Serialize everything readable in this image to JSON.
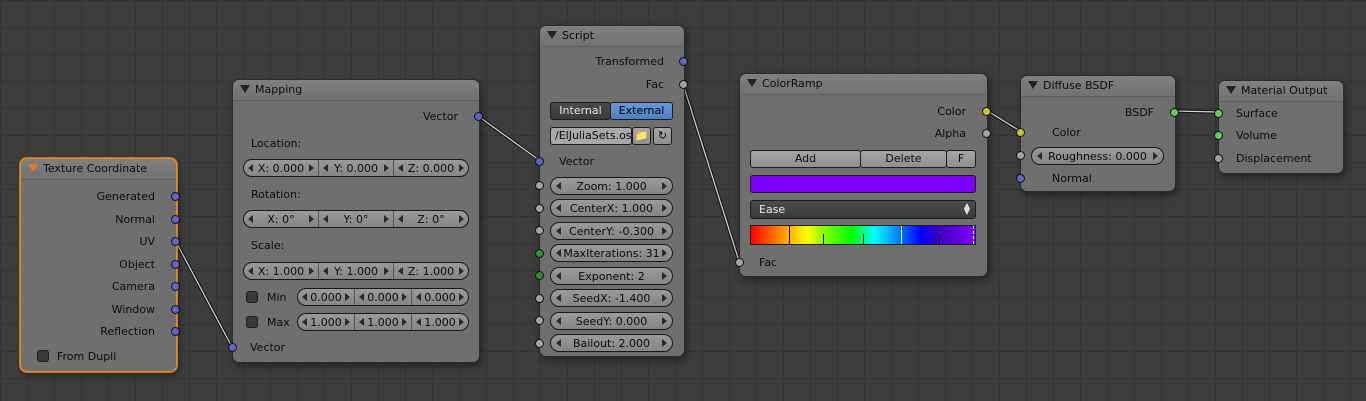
{
  "nodes": {
    "texcoord": {
      "title": "Texture Coordinate",
      "outputs": [
        "Generated",
        "Normal",
        "UV",
        "Object",
        "Camera",
        "Window",
        "Reflection"
      ],
      "from_dupli": "From Dupli"
    },
    "mapping": {
      "title": "Mapping",
      "output": "Vector",
      "location_label": "Location:",
      "location": [
        "X: 0.000",
        "Y: 0.000",
        "Z: 0.000"
      ],
      "rotation_label": "Rotation:",
      "rotation": [
        "X: 0°",
        "Y: 0°",
        "Z: 0°"
      ],
      "scale_label": "Scale:",
      "scale": [
        "X: 1.000",
        "Y: 1.000",
        "Z: 1.000"
      ],
      "min_label": "Min",
      "min": [
        "0.000",
        "0.000",
        "0.000"
      ],
      "max_label": "Max",
      "max": [
        "1.000",
        "1.000",
        "1.000"
      ],
      "input": "Vector"
    },
    "script": {
      "title": "Script",
      "outputs": [
        "Transformed",
        "Fac"
      ],
      "mode_internal": "Internal",
      "mode_external": "External",
      "filepath": "/ElJuliaSets.osl",
      "vector_input": "Vector",
      "params": [
        "Zoom: 1.000",
        "CenterX: 1.000",
        "CenterY: -0.300",
        "MaxIterations: 31",
        "Exponent: 2",
        "SeedX: -1.400",
        "SeedY: 0.000",
        "Bailout: 2.000"
      ]
    },
    "colorramp": {
      "title": "ColorRamp",
      "outputs": [
        "Color",
        "Alpha"
      ],
      "add": "Add",
      "delete": "Delete",
      "flip": "F",
      "active_color": "#8000ff",
      "interpolation": "Ease",
      "input": "Fac"
    },
    "diffuse": {
      "title": "Diffuse BSDF",
      "output": "BSDF",
      "color_input": "Color",
      "roughness": "Roughness: 0.000",
      "normal_input": "Normal"
    },
    "output": {
      "title": "Material Output",
      "inputs": [
        "Surface",
        "Volume",
        "Displacement"
      ]
    }
  }
}
